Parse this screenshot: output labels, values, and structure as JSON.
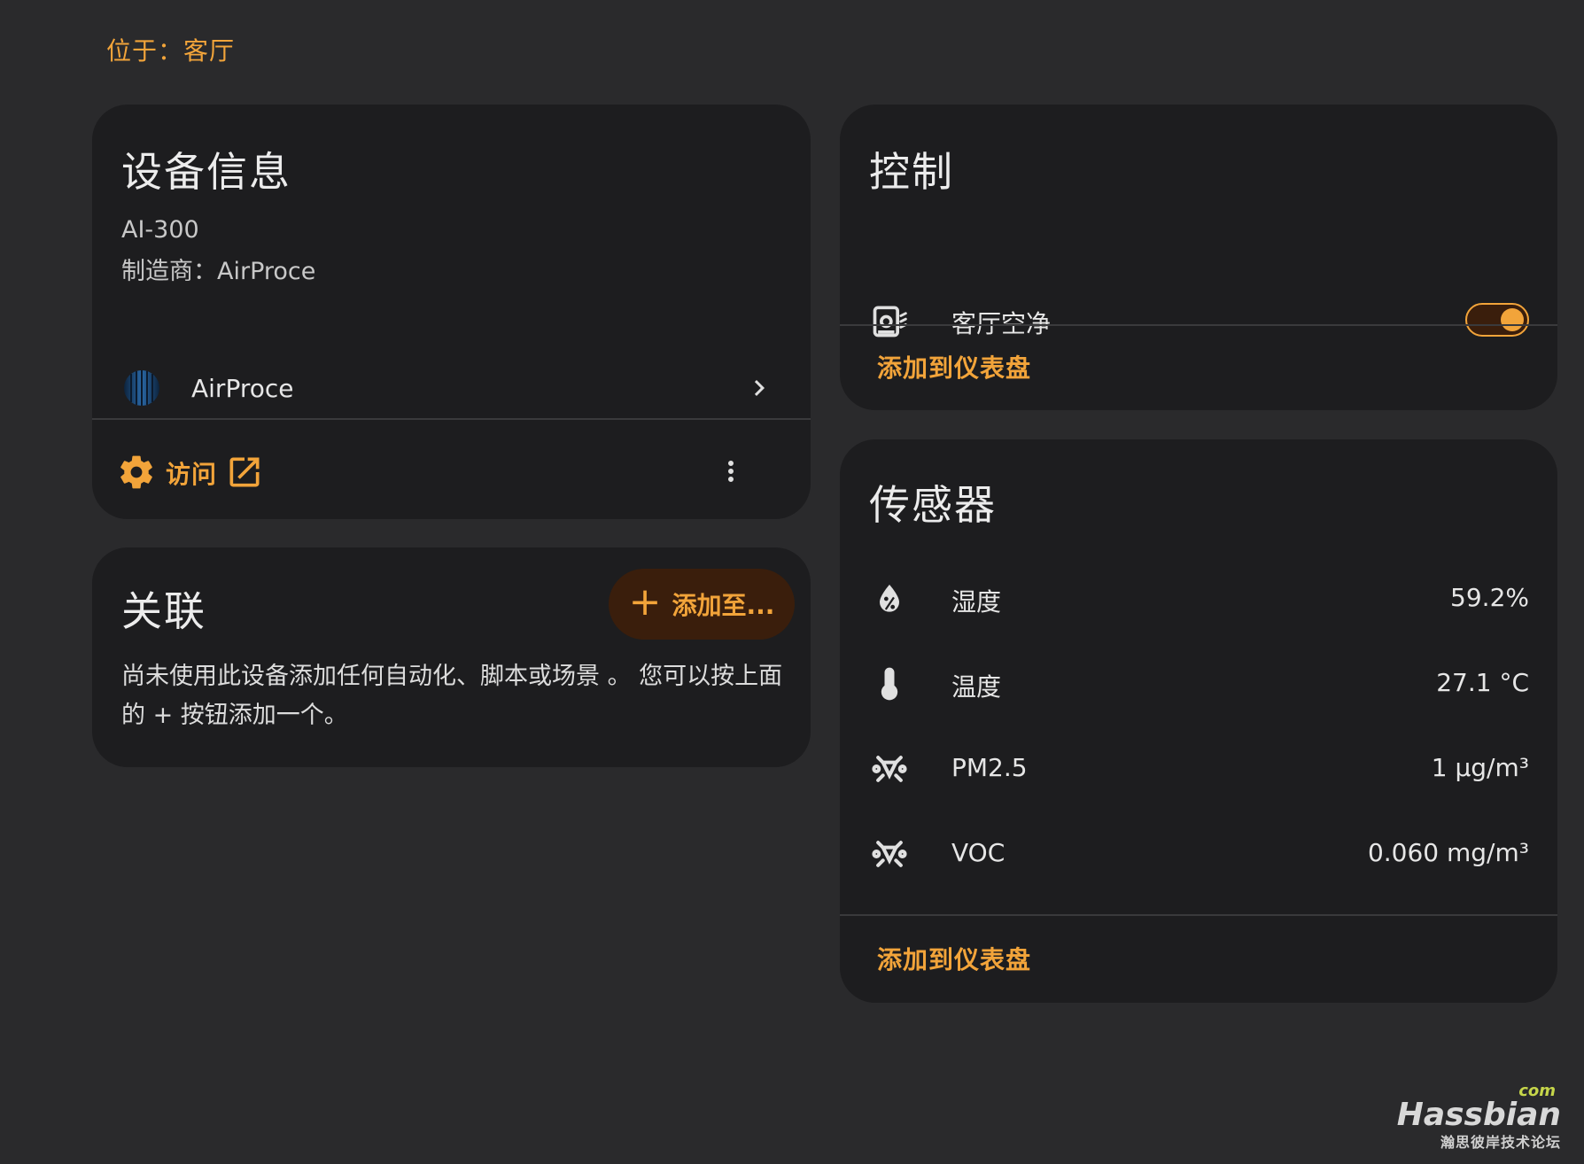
{
  "location": "位于：客厅",
  "device_info": {
    "title": "设备信息",
    "model": "AI-300",
    "manufacturer": "制造商：AirProce",
    "integration": {
      "name": "AirProce",
      "logo": "airproce-logo"
    },
    "visit_label": "访问"
  },
  "related": {
    "title": "关联",
    "add_button": "添加至...",
    "add_icon": "+",
    "description": "尚未使用此设备添加任何自动化、脚本或场景 。 您可以按上面的 + 按钮添加一个。"
  },
  "controls": {
    "title": "控制",
    "items": [
      {
        "name": "客厅空净",
        "icon": "air-purifier-icon",
        "state": "on"
      }
    ],
    "add_to_dashboard": "添加到仪表盘"
  },
  "sensors": {
    "title": "传感器",
    "items": [
      {
        "name": "湿度",
        "value": "59.2%",
        "icon": "water-percent-icon"
      },
      {
        "name": "温度",
        "value": "27.1 °C",
        "icon": "thermometer-icon"
      },
      {
        "name": "PM2.5",
        "value": "1 µg/m³",
        "icon": "molecule-icon"
      },
      {
        "name": "VOC",
        "value": "0.060 mg/m³",
        "icon": "molecule-icon"
      }
    ],
    "add_to_dashboard": "添加到仪表盘"
  },
  "watermark": {
    "com": "com",
    "brand": "Hassbian",
    "sub": "瀚思彼岸技术论坛"
  },
  "colors": {
    "accent": "#f2a43a",
    "background": "#2a2a2c",
    "card": "#1d1d1f",
    "button_bg": "#3a1e0c"
  }
}
